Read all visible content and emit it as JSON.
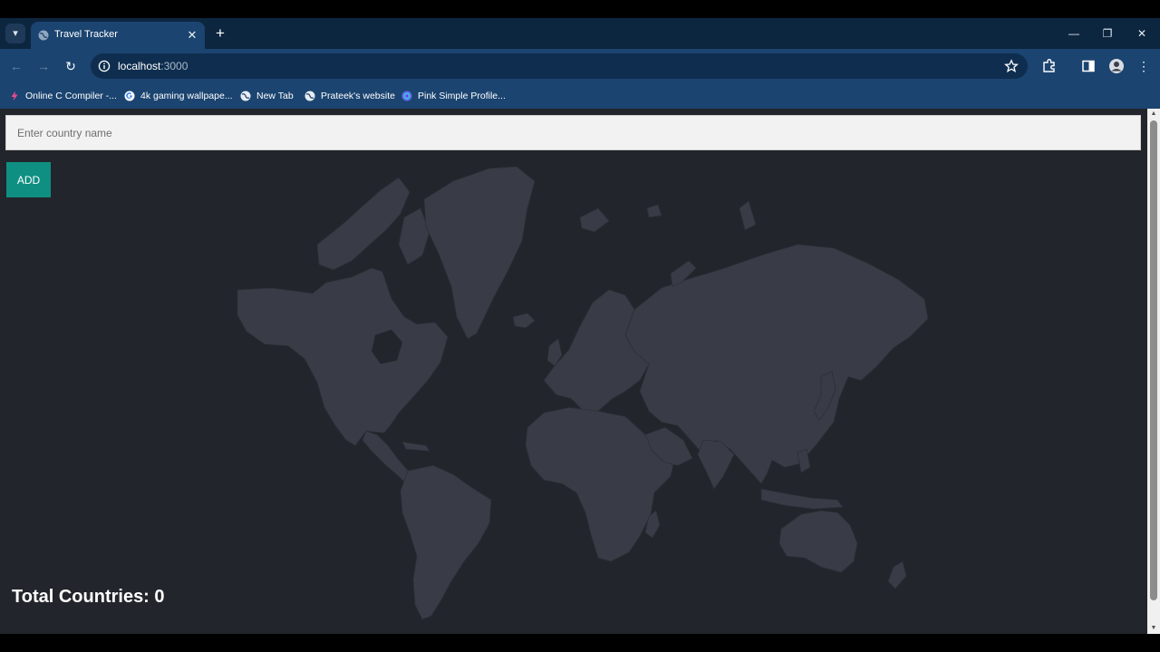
{
  "browser": {
    "tab_title": "Travel Tracker",
    "address_host": "localhost",
    "address_port": ":3000",
    "bookmarks": [
      {
        "label": "Online C Compiler -...",
        "icon": "bolt-icon"
      },
      {
        "label": "4k gaming wallpape...",
        "icon": "google-icon"
      },
      {
        "label": "New Tab",
        "icon": "globe-icon"
      },
      {
        "label": "Prateek's website",
        "icon": "globe-icon"
      },
      {
        "label": "Pink Simple Profile...",
        "icon": "canva-icon"
      }
    ]
  },
  "page": {
    "input_placeholder": "Enter country name",
    "input_value": "",
    "add_label": "ADD",
    "total_label": "Total Countries: 0"
  },
  "colors": {
    "page_background": "#22252b",
    "land": "#393c46",
    "button": "#0f8f82",
    "browser_frame": "#1b4470"
  }
}
